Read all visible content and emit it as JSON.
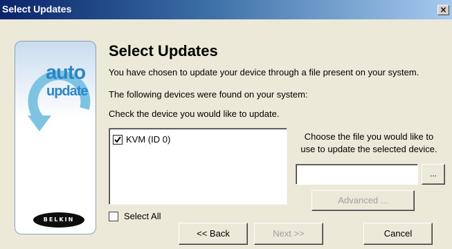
{
  "window": {
    "title": "Select Updates",
    "close_glyph": "×"
  },
  "side_panel": {
    "logo_line1": "auto",
    "logo_line2": "update",
    "brand": "BELKIN"
  },
  "main": {
    "heading": "Select Updates",
    "line1": "You have chosen to update your device through a file present on your system.",
    "line2": "The following devices were found on your system:",
    "line3": "Check the device you would like to update."
  },
  "devices": [
    {
      "label": "KVM (ID 0)",
      "checked": true
    }
  ],
  "file_section": {
    "prompt_line1": "Choose the file you would like to",
    "prompt_line2": "use to update the selected device.",
    "file_value": "",
    "browse_label": "...",
    "advanced_label": "Advanced ..."
  },
  "select_all": {
    "label": "Select All",
    "checked": false
  },
  "buttons": {
    "back": "<< Back",
    "next": "Next >>",
    "cancel": "Cancel"
  },
  "colors": {
    "title_gradient_start": "#0a246a",
    "title_gradient_end": "#a6caf0",
    "logo_blue": "#2b86c7",
    "disabled_text": "#a0a0a0",
    "dialog_bg": "#ece9d8"
  }
}
